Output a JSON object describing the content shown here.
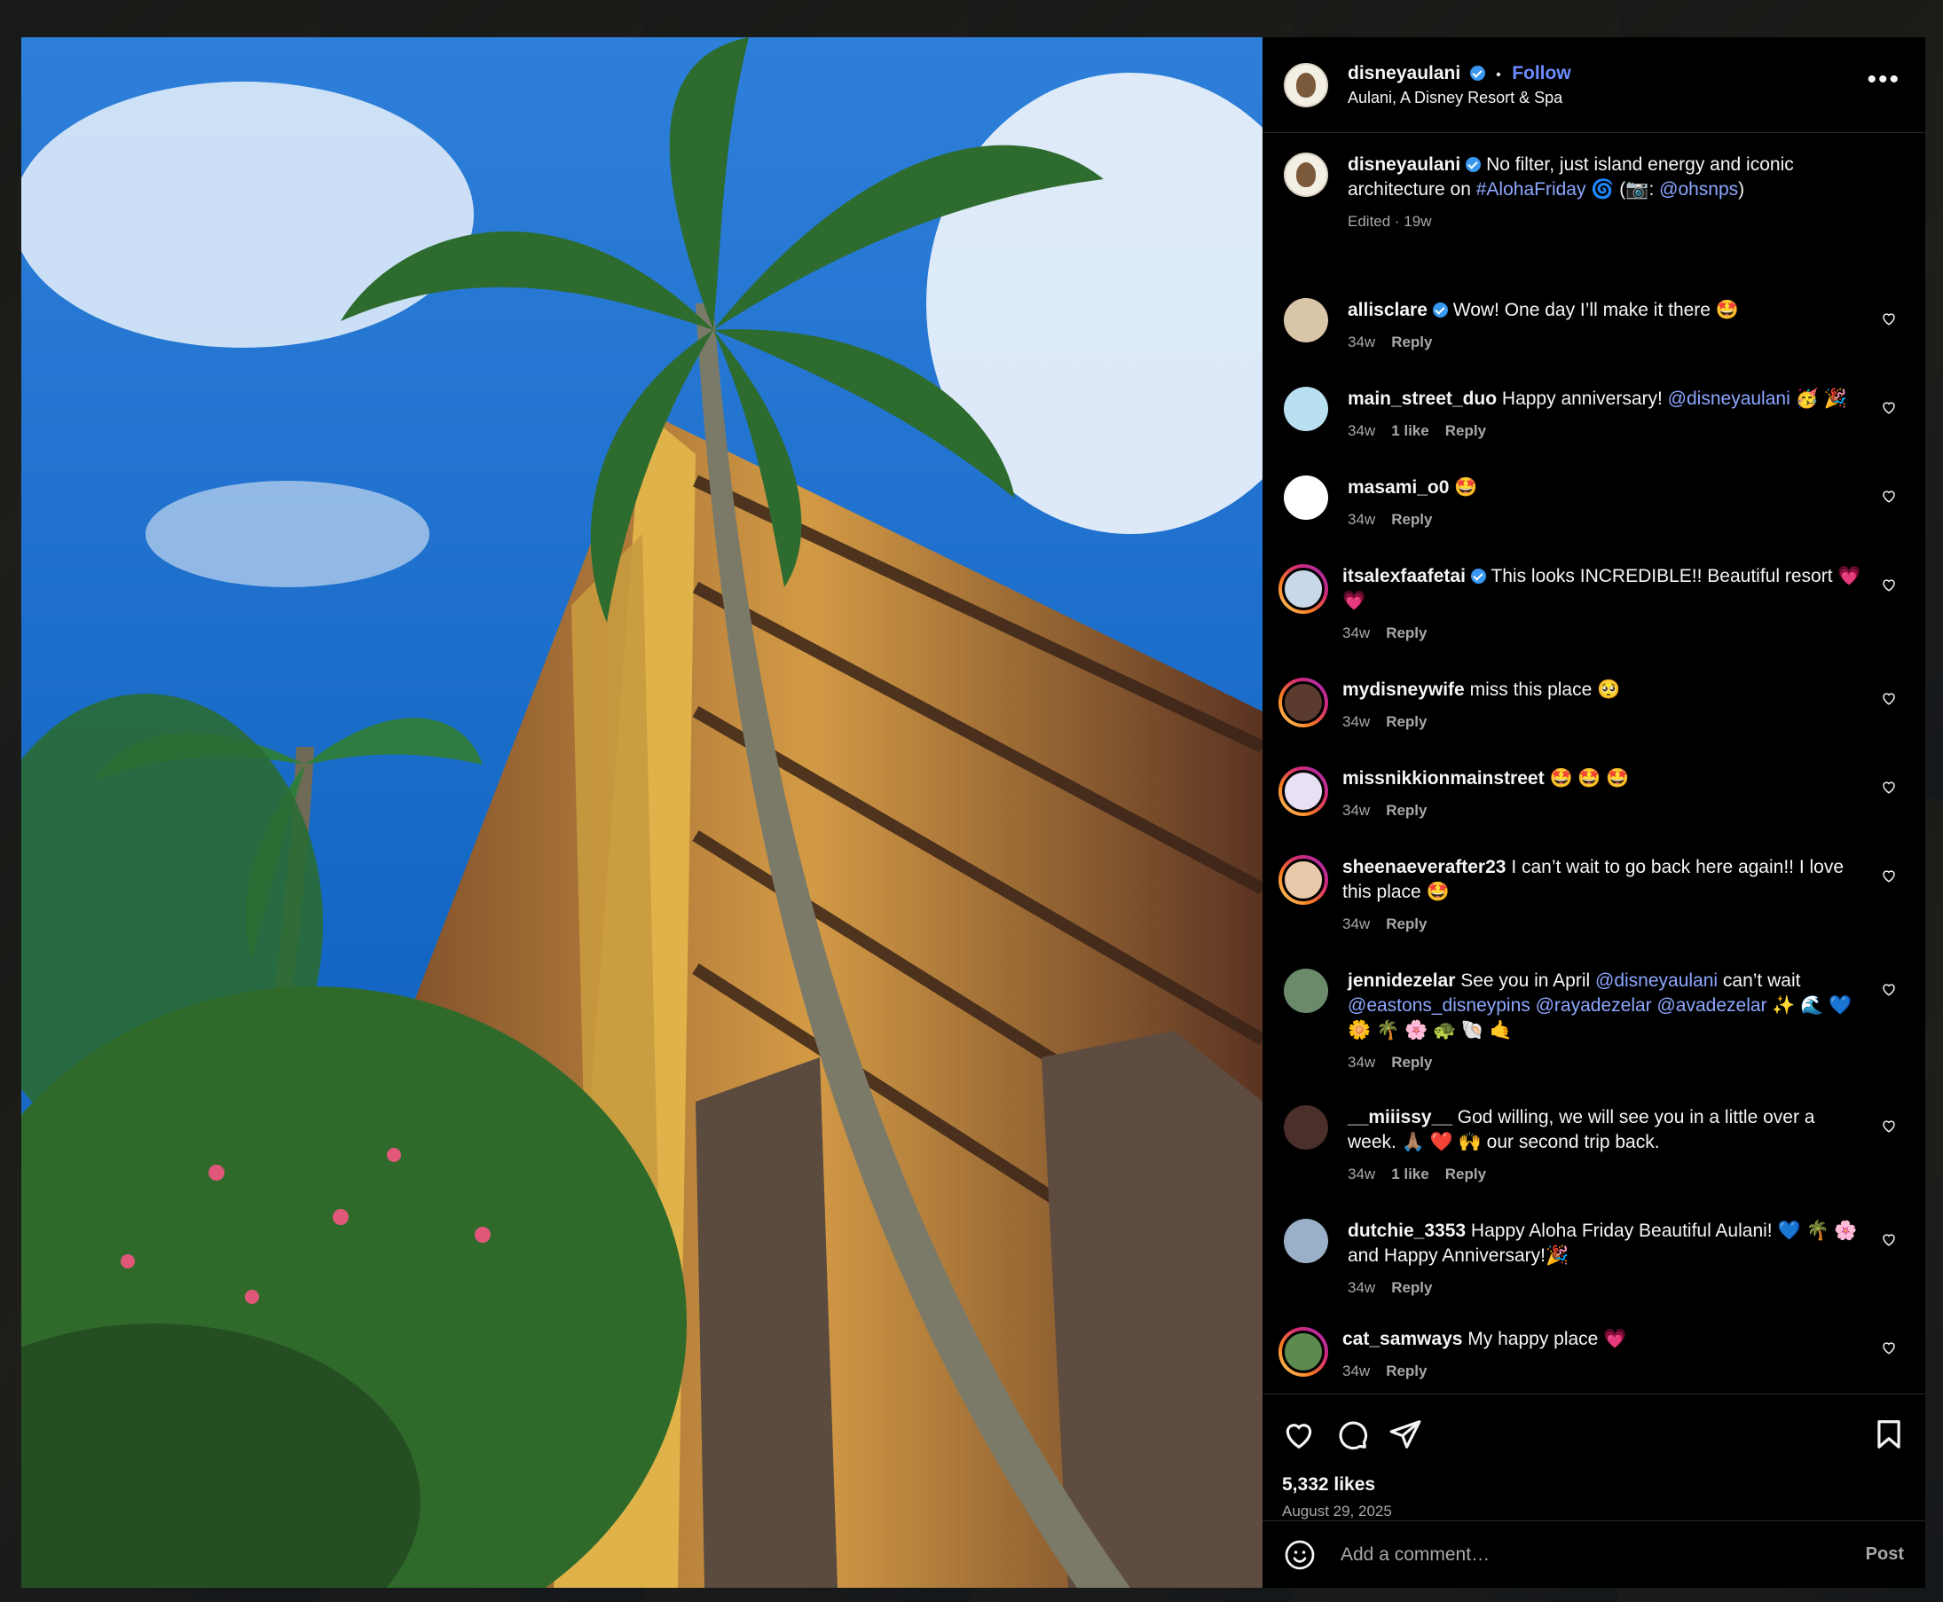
{
  "post": {
    "username": "disneyaulani",
    "follow_label": "Follow",
    "location": "Aulani, A Disney Resort & Spa",
    "caption_text": "No filter, just island energy and iconic architecture on ",
    "caption_hashtag": "#AlohaFriday",
    "caption_tail": " 🌀 (📷: ",
    "caption_mention": "@ohsnps",
    "caption_close": ")",
    "caption_meta": "Edited · 19w",
    "likes": "5,332 likes",
    "date": "August 29, 2025"
  },
  "comments": [
    {
      "user": "allisclare",
      "verified": true,
      "text": "Wow! One day I’ll make it there 🤩",
      "age": "34w",
      "likes": "",
      "reply": "Reply"
    },
    {
      "user": "main_street_duo",
      "verified": false,
      "text": "Happy anniversary! ",
      "mention": "@disneyaulani",
      "tail": " 🥳 🎉",
      "age": "34w",
      "likes": "1 like",
      "reply": "Reply"
    },
    {
      "user": "masami_o0",
      "verified": false,
      "text": "🤩",
      "age": "34w",
      "likes": "",
      "reply": "Reply"
    },
    {
      "user": "itsalexfaafetai",
      "verified": true,
      "text": "This looks INCREDIBLE!! Beautiful resort 💗 💗",
      "age": "34w",
      "likes": "",
      "reply": "Reply"
    },
    {
      "user": "mydisneywife",
      "verified": false,
      "text": "miss this place 🥺",
      "age": "34w",
      "likes": "",
      "reply": "Reply"
    },
    {
      "user": "missnikkionmainstreet",
      "verified": false,
      "text": "🤩 🤩 🤩",
      "age": "34w",
      "likes": "",
      "reply": "Reply"
    },
    {
      "user": "sheenaeverafter23",
      "verified": false,
      "text": "I can’t wait to go back here again!! I love this place 🤩",
      "age": "34w",
      "likes": "",
      "reply": "Reply"
    },
    {
      "user": "jennidezelar",
      "verified": false,
      "text": "See you in April ",
      "mention": "@disneyaulani",
      "tail": " can’t wait ",
      "mention2": "@eastons_disneypins @rayadezelar @avadezelar",
      "tail2": " ✨ 🌊 💙 🌼 🌴 🌸 🐢 🐚 🤙",
      "age": "34w",
      "likes": "",
      "reply": "Reply"
    },
    {
      "user": "__miiissy__",
      "verified": false,
      "text": "God willing, we will see you in a little over a week. 🙏🏽 ❤️ 🙌 our second trip back.",
      "age": "34w",
      "likes": "1 like",
      "reply": "Reply"
    },
    {
      "user": "dutchie_3353",
      "verified": false,
      "text": "Happy Aloha Friday Beautiful Aulani! 💙 🌴 🌸 and Happy Anniversary!🎉",
      "age": "34w",
      "likes": "",
      "reply": "Reply"
    },
    {
      "user": "cat_samways",
      "verified": false,
      "text": "My happy place 💗",
      "age": "34w",
      "likes": "",
      "reply": "Reply"
    }
  ],
  "composer": {
    "placeholder": "Add a comment…",
    "post_label": "Post"
  },
  "colors": {
    "panel_bg": "#000000",
    "link": "#8da7ff",
    "follow": "#6b8cff",
    "muted": "#a8a8a8",
    "verified": "#3897f0"
  }
}
